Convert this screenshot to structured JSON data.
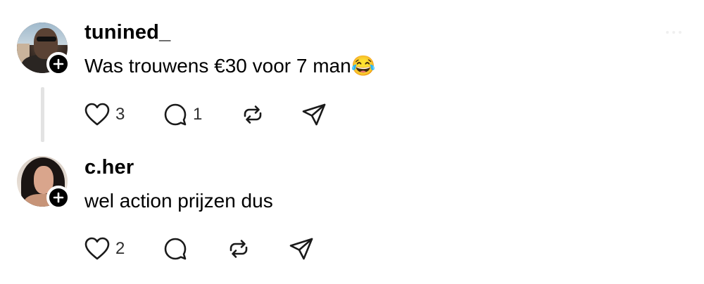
{
  "posts": [
    {
      "username": "tunined_",
      "text": "Was trouwens €30 voor 7 man😂",
      "likes": "3",
      "replies": "1",
      "avatar": "profile-photo-man-sunglasses",
      "follow_icon": "plus-icon"
    },
    {
      "username": "c.her",
      "text": "wel action prijzen dus",
      "likes": "2",
      "replies": "",
      "avatar": "profile-photo-woman",
      "follow_icon": "plus-icon"
    }
  ],
  "icons": {
    "like": "heart-icon",
    "reply": "comment-icon",
    "repost": "repost-icon",
    "share": "send-icon",
    "more": "more-dots-icon"
  },
  "colors": {
    "text": "#000000",
    "count": "#2e2e2e",
    "thread_line": "#e3e3e3",
    "badge": "#000000"
  }
}
